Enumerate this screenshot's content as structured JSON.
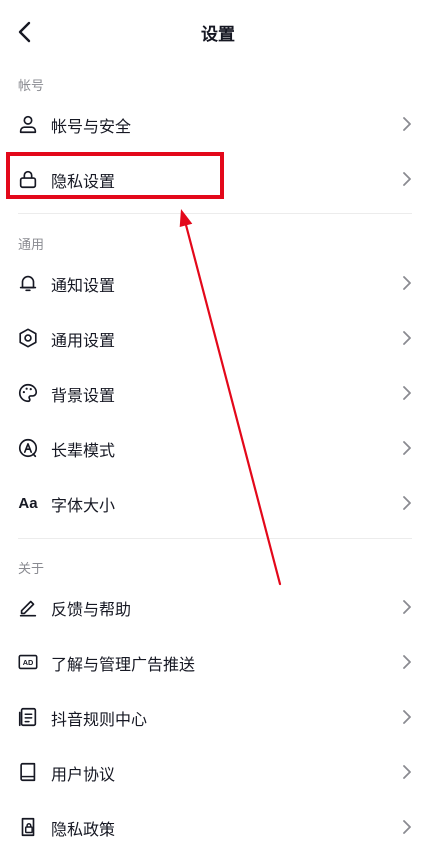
{
  "header": {
    "title": "设置"
  },
  "sections": [
    {
      "label": "帐号"
    },
    {
      "label": "通用"
    },
    {
      "label": "关于"
    }
  ],
  "rows": {
    "account": "帐号与安全",
    "privacy": "隐私设置",
    "notifications": "通知设置",
    "general": "通用设置",
    "background": "背景设置",
    "elder": "长辈模式",
    "font_size": "字体大小",
    "feedback": "反馈与帮助",
    "ads": "了解与管理广告推送",
    "rules": "抖音规则中心",
    "agreement": "用户协议",
    "privacy_policy": "隐私政策"
  },
  "icons": {
    "font_size_glyph": "Aa",
    "ad_glyph": "AD"
  },
  "colors": {
    "highlight": "#e3081a",
    "text": "#161823",
    "muted": "#8a8b91"
  }
}
